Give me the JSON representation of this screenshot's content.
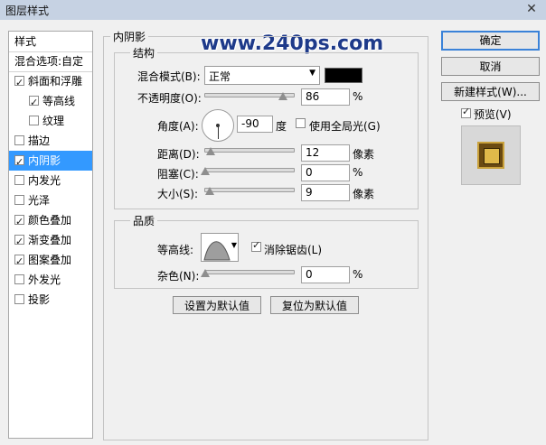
{
  "window": {
    "title": "图层样式",
    "close_glyph": "✕"
  },
  "styles_panel": {
    "header": "样式",
    "blend_options": "混合选项:自定",
    "items": [
      {
        "label": "斜面和浮雕",
        "checked": true
      },
      {
        "label": "等高线",
        "checked": true
      },
      {
        "label": "纹理",
        "checked": false
      },
      {
        "label": "描边",
        "checked": false
      },
      {
        "label": "内阴影",
        "checked": true
      },
      {
        "label": "内发光",
        "checked": false
      },
      {
        "label": "光泽",
        "checked": false
      },
      {
        "label": "颜色叠加",
        "checked": true
      },
      {
        "label": "渐变叠加",
        "checked": true
      },
      {
        "label": "图案叠加",
        "checked": true
      },
      {
        "label": "外发光",
        "checked": false
      },
      {
        "label": "投影",
        "checked": false
      }
    ]
  },
  "watermark": "www.240ps.com",
  "section": {
    "title": "内阴影"
  },
  "structure": {
    "title": "结构",
    "blend_mode": {
      "label": "混合模式(B):",
      "value": "正常",
      "color": "#000000"
    },
    "opacity": {
      "label": "不透明度(O):",
      "value": "86",
      "unit": "%",
      "level": 0.86
    },
    "angle": {
      "label": "角度(A):",
      "value": "-90",
      "unit": "度",
      "global_light_label": "使用全局光(G)",
      "global_light": false
    },
    "distance": {
      "label": "距离(D):",
      "value": "12",
      "unit": "像素",
      "level": 0.06
    },
    "choke": {
      "label": "阻塞(C):",
      "value": "0",
      "unit": "%",
      "level": 0.0
    },
    "size": {
      "label": "大小(S):",
      "value": "9",
      "unit": "像素",
      "level": 0.05
    }
  },
  "quality": {
    "title": "品质",
    "contour": {
      "label": "等高线:",
      "antialias_label": "消除锯齿(L)",
      "antialias": true
    },
    "noise": {
      "label": "杂色(N):",
      "value": "0",
      "unit": "%",
      "level": 0.0
    }
  },
  "buttons": {
    "set_default": "设置为默认值",
    "reset_default": "复位为默认值",
    "ok": "确定",
    "cancel": "取消",
    "new_style": "新建样式(W)...",
    "preview": "预览(V)"
  },
  "colors": {
    "accent": "#3399ff",
    "ok_border": "#3a82d8"
  }
}
